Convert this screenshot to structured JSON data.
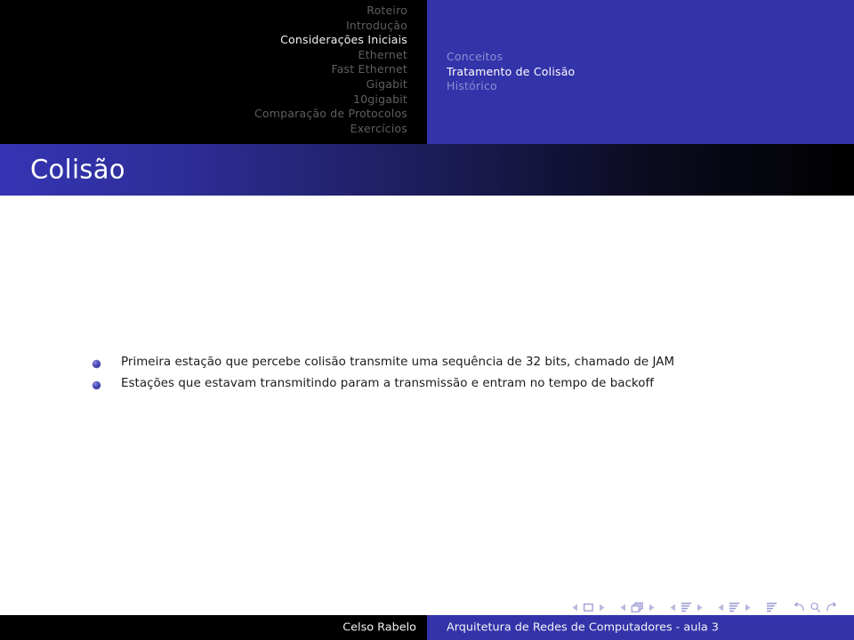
{
  "slide": {
    "title": "Colisão"
  },
  "header": {
    "sections": [
      {
        "label": "Roteiro",
        "current": false
      },
      {
        "label": "Introdução",
        "current": false
      },
      {
        "label": "Considerações Iniciais",
        "current": true
      },
      {
        "label": "Ethernet",
        "current": false
      },
      {
        "label": "Fast Ethernet",
        "current": false
      },
      {
        "label": "Gigabit",
        "current": false
      },
      {
        "label": "10gigabit",
        "current": false
      },
      {
        "label": "Comparação de Protocolos",
        "current": false
      },
      {
        "label": "Exercícios",
        "current": false
      }
    ],
    "subsections": [
      {
        "label": "Conceitos",
        "current": false
      },
      {
        "label": "Tratamento de Colisão",
        "current": true
      },
      {
        "label": "Histórico",
        "current": false
      }
    ]
  },
  "content": {
    "bullets": [
      "Primeira estação que percebe colisão transmite uma sequência de 32 bits, chamado de JAM",
      "Estações que estavam transmitindo param a transmissão e entram no tempo de backoff"
    ]
  },
  "navigation": {
    "icons": [
      "prev-slide-arrow-icon",
      "slide-icon",
      "next-slide-arrow-icon",
      "prev-frame-arrow-icon",
      "frames-icon",
      "next-frame-arrow-icon",
      "prev-subsection-arrow-icon",
      "subsection-icon",
      "next-subsection-arrow-icon",
      "prev-section-arrow-icon",
      "section-icon",
      "next-section-arrow-icon",
      "document-icon",
      "back-arrow-icon",
      "search-icon",
      "forward-arrow-icon"
    ]
  },
  "footer": {
    "author": "Celso Rabelo",
    "title": "Arquitetura de Redes de Computadores - aula 3"
  },
  "colors": {
    "accent_blue": "#3333aa",
    "header_dark": "#000000",
    "title_text": "#ffffff",
    "section_inactive": "#5f5f5f",
    "subsection_inactive": "#8e8ed4",
    "bullet_text": "#1a1a1a",
    "nav_symbol": "#9a9ad0"
  }
}
